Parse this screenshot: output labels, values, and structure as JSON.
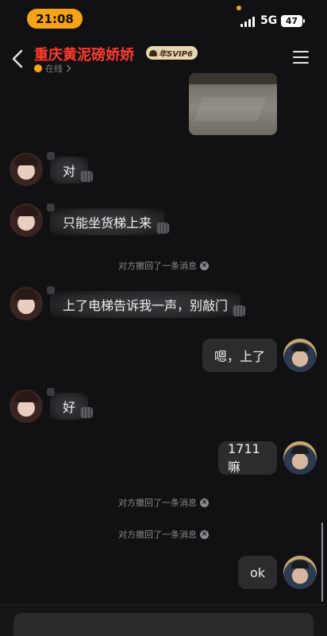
{
  "status_bar": {
    "time": "21:08",
    "network": "5G",
    "battery": "47"
  },
  "header": {
    "contact_name": "重庆黄泥磅娇娇",
    "vip_badge": "年SVIP6",
    "status_text": "在线"
  },
  "messages": [
    {
      "type": "incoming",
      "text": "对"
    },
    {
      "type": "incoming",
      "text": "只能坐货梯上来"
    },
    {
      "type": "system",
      "text": "对方撤回了一条消息"
    },
    {
      "type": "incoming",
      "text": "上了电梯告诉我一声，别敲门"
    },
    {
      "type": "outgoing",
      "text": "嗯，上了"
    },
    {
      "type": "incoming",
      "text": "好"
    },
    {
      "type": "outgoing",
      "text": "1711嘛"
    },
    {
      "type": "system",
      "text": "对方撤回了一条消息"
    },
    {
      "type": "system",
      "text": "对方撤回了一条消息"
    },
    {
      "type": "outgoing",
      "text": "ok"
    }
  ],
  "input": {
    "placeholder": ""
  }
}
